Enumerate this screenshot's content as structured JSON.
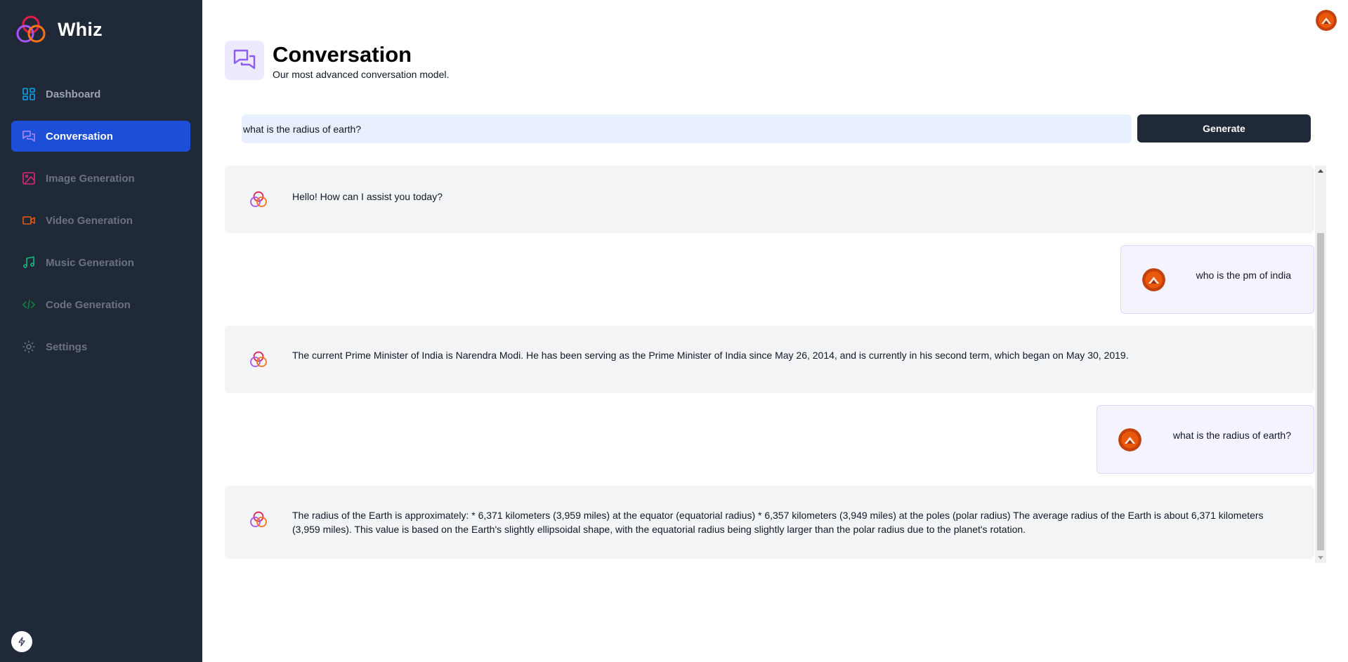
{
  "app": {
    "name": "Whiz"
  },
  "sidebar": {
    "items": [
      {
        "label": "Dashboard",
        "icon": "dashboard-icon",
        "color": "#0ea5e9"
      },
      {
        "label": "Conversation",
        "icon": "chat-icon",
        "color": "#8b5cf6",
        "active": true
      },
      {
        "label": "Image Generation",
        "icon": "image-icon",
        "color": "#db2777"
      },
      {
        "label": "Video Generation",
        "icon": "video-icon",
        "color": "#ea580c"
      },
      {
        "label": "Music Generation",
        "icon": "music-icon",
        "color": "#10b981"
      },
      {
        "label": "Code Generation",
        "icon": "code-icon",
        "color": "#15803d"
      },
      {
        "label": "Settings",
        "icon": "gear-icon",
        "color": "#6b7280"
      }
    ]
  },
  "header": {
    "title": "Conversation",
    "subtitle": "Our most advanced conversation model."
  },
  "prompt": {
    "value": "what is the radius of earth?",
    "button_label": "Generate"
  },
  "messages": [
    {
      "role": "bot",
      "text": "Hello! How can I assist you today?"
    },
    {
      "role": "user",
      "text": "who is the pm of india"
    },
    {
      "role": "bot",
      "text": "The current Prime Minister of India is Narendra Modi. He has been serving as the Prime Minister of India since May 26, 2014, and is currently in his second term, which began on May 30, 2019."
    },
    {
      "role": "user",
      "text": "what is the radius of earth?"
    },
    {
      "role": "bot",
      "text": "The radius of the Earth is approximately: * 6,371 kilometers (3,959 miles) at the equator (equatorial radius) * 6,357 kilometers (3,949 miles) at the poles (polar radius) The average radius of the Earth is about 6,371 kilometers (3,959 miles). This value is based on the Earth's slightly ellipsoidal shape, with the equatorial radius being slightly larger than the polar radius due to the planet's rotation."
    }
  ],
  "colors": {
    "sidebar_bg": "#1f2937",
    "active_item": "#1d4ed8",
    "accent_purple": "#8b5cf6"
  }
}
